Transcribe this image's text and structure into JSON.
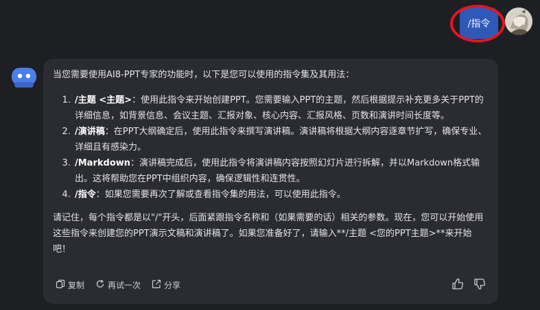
{
  "user_message": {
    "text": "/指令"
  },
  "bot_message": {
    "intro": "当您需要使用AI8-PPT专家的功能时，以下是您可以使用的指令集及其用法：",
    "commands": [
      {
        "keyword": "/主题 <主题>",
        "description": "：使用此指令来开始创建PPT。您需要输入PPT的主题，然后根据提示补充更多关于PPT的详细信息，如背景信息、会议主题、汇报对象、核心内容、汇报风格、页数和演讲时间长度等。"
      },
      {
        "keyword": "/演讲稿",
        "description": "：在PPT大纲确定后，使用此指令来撰写演讲稿。演讲稿将根据大纲内容逐章节扩写，确保专业、详细且有感染力。"
      },
      {
        "keyword": "/Markdown",
        "description": "：演讲稿完成后，使用此指令将演讲稿内容按照幻灯片进行拆解，并以Markdown格式输出。这将帮助您在PPT中组织内容，确保逻辑性和连贯性。"
      },
      {
        "keyword": "/指令",
        "description": "：如果您需要再次了解或查看指令集的用法，可以使用此指令。"
      }
    ],
    "outro": "请记住，每个指令都是以\"/\"开头，后面紧跟指令名称和（如果需要的话）相关的参数。现在，您可以开始使用这些指令来创建您的PPT演示文稿和演讲稿了。如果您准备好了，请输入**/主题 <您的PPT主题>**来开始吧！"
  },
  "actions": {
    "copy": "复制",
    "retry": "再试一次",
    "share": "分享"
  },
  "colors": {
    "background": "#1e1f23",
    "card": "#2b2c31",
    "user_bubble": "#2f59b8",
    "highlight_circle": "#e8141e",
    "bot_avatar": "#4a7ee8"
  }
}
